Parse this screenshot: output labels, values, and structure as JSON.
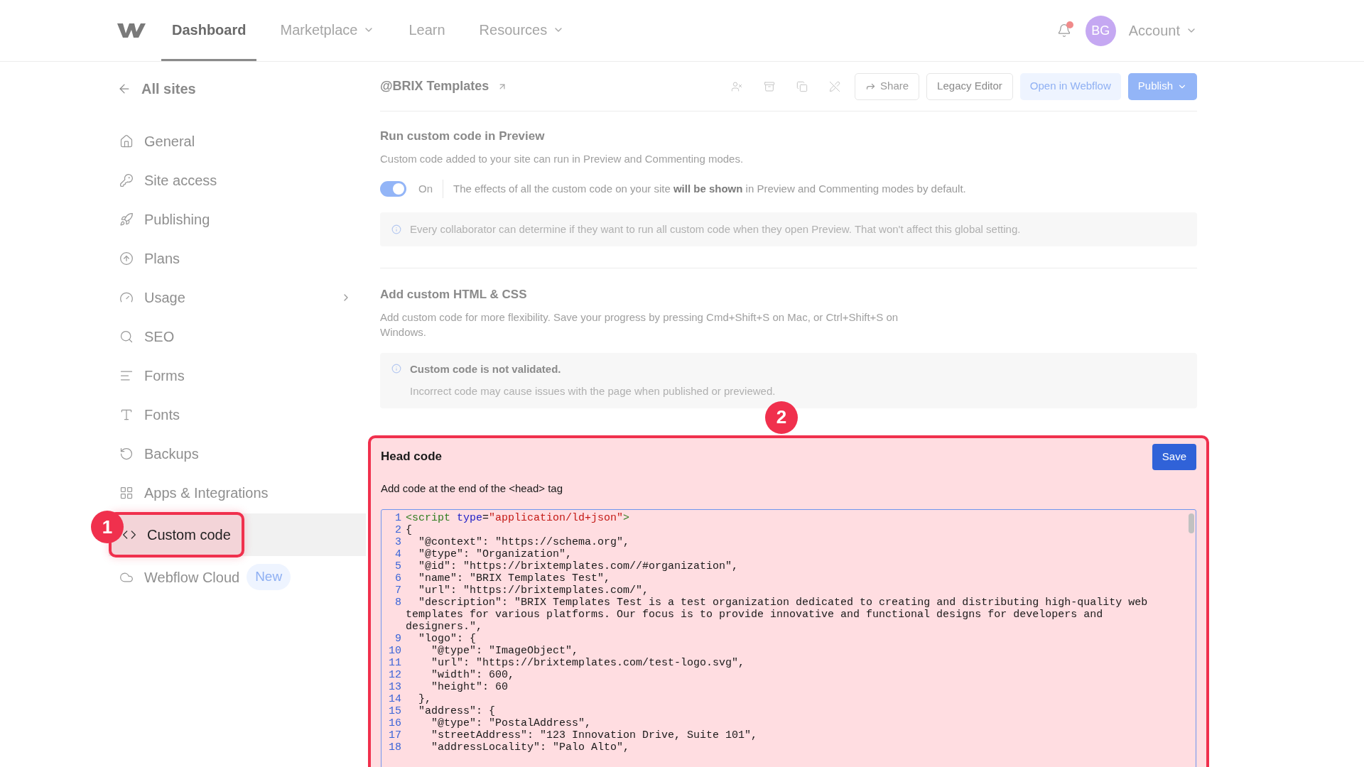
{
  "nav": {
    "items": [
      {
        "label": "Dashboard",
        "selected": true,
        "dropdown": false
      },
      {
        "label": "Marketplace",
        "selected": false,
        "dropdown": true
      },
      {
        "label": "Learn",
        "selected": false,
        "dropdown": false
      },
      {
        "label": "Resources",
        "selected": false,
        "dropdown": true
      }
    ],
    "notifications": {
      "unread": true
    },
    "avatar": "BG",
    "account": "Account"
  },
  "sidebar": {
    "back": "All sites",
    "items": [
      {
        "label": "General",
        "selected": false
      },
      {
        "label": "Site access",
        "selected": false
      },
      {
        "label": "Publishing",
        "selected": false
      },
      {
        "label": "Plans",
        "selected": false
      },
      {
        "label": "Usage",
        "selected": false,
        "has_submenu": true
      },
      {
        "label": "SEO",
        "selected": false
      },
      {
        "label": "Forms",
        "selected": false
      },
      {
        "label": "Fonts",
        "selected": false
      },
      {
        "label": "Backups",
        "selected": false
      },
      {
        "label": "Apps & Integrations",
        "selected": false
      },
      {
        "label": "Custom code",
        "selected": true,
        "annotation": "1"
      },
      {
        "label": "Webflow Cloud",
        "selected": false,
        "badge": "New"
      }
    ]
  },
  "header": {
    "site": "@BRIX Templates",
    "buttons": [
      {
        "label": "Share",
        "kind": "share"
      },
      {
        "label": "Legacy Editor",
        "kind": "plain"
      },
      {
        "label": "Open in Webflow",
        "kind": "soft"
      },
      {
        "label": "Publish",
        "kind": "primary"
      }
    ]
  },
  "preview_section": {
    "title": "Run custom code in Preview",
    "description": "Custom code added to your site can run in Preview and Commenting modes.",
    "toggle": {
      "on": true,
      "label": "On"
    },
    "toggle_text": "The effects of all the custom code on your site **will be shown** in Preview and Commenting modes by default.",
    "info": "Every collaborator can determine if they want to run all custom code when they open Preview. That won't affect this global setting."
  },
  "html_section": {
    "title": "Add custom HTML & CSS",
    "description": "Add custom code for more flexibility. Save your progress by pressing Cmd+Shift+S on Mac, or Ctrl+Shift+S on Windows.",
    "info_title": "Custom code is not validated.",
    "info_text": "Incorrect code may cause issues with the page when published or previewed."
  },
  "head_code": {
    "annotation": "2",
    "title": "Head code",
    "save": "Save",
    "hint": "Add code at the end of the <head> tag",
    "lines": [
      {
        "number": "1",
        "parts": [
          {
            "kind": "tag",
            "text": "<script"
          },
          {
            "kind": "attr",
            "text": " type"
          },
          {
            "kind": "plain",
            "text": "="
          },
          {
            "kind": "string",
            "text": "\"application/ld+json\""
          },
          {
            "kind": "tag",
            "text": ">"
          }
        ]
      },
      {
        "number": "2",
        "parts": [
          {
            "kind": "plain",
            "text": "{"
          }
        ]
      },
      {
        "number": "3",
        "parts": [
          {
            "kind": "plain",
            "text": "  \"@context\": \"https://schema.org\","
          }
        ]
      },
      {
        "number": "4",
        "parts": [
          {
            "kind": "plain",
            "text": "  \"@type\": \"Organization\","
          }
        ]
      },
      {
        "number": "5",
        "parts": [
          {
            "kind": "plain",
            "text": "  \"@id\": \"https://brixtemplates.com//#organization\","
          }
        ]
      },
      {
        "number": "6",
        "parts": [
          {
            "kind": "plain",
            "text": "  \"name\": \"BRIX Templates Test\","
          }
        ]
      },
      {
        "number": "7",
        "parts": [
          {
            "kind": "plain",
            "text": "  \"url\": \"https://brixtemplates.com/\","
          }
        ]
      },
      {
        "number": "8",
        "parts": [
          {
            "kind": "plain",
            "text": "  \"description\": \"BRIX Templates Test is a test organization dedicated to creating and distributing high-quality web templates for various platforms. Our focus is to provide innovative and functional designs for developers and designers.\","
          }
        ]
      },
      {
        "number": "9",
        "parts": [
          {
            "kind": "plain",
            "text": "  \"logo\": {"
          }
        ]
      },
      {
        "number": "10",
        "parts": [
          {
            "kind": "plain",
            "text": "    \"@type\": \"ImageObject\","
          }
        ]
      },
      {
        "number": "11",
        "parts": [
          {
            "kind": "plain",
            "text": "    \"url\": \"https://brixtemplates.com/test-logo.svg\","
          }
        ]
      },
      {
        "number": "12",
        "parts": [
          {
            "kind": "plain",
            "text": "    \"width\": 600,"
          }
        ]
      },
      {
        "number": "13",
        "parts": [
          {
            "kind": "plain",
            "text": "    \"height\": 60"
          }
        ]
      },
      {
        "number": "14",
        "parts": [
          {
            "kind": "plain",
            "text": "  },"
          }
        ]
      },
      {
        "number": "15",
        "parts": [
          {
            "kind": "plain",
            "text": "  \"address\": {"
          }
        ]
      },
      {
        "number": "16",
        "parts": [
          {
            "kind": "plain",
            "text": "    \"@type\": \"PostalAddress\","
          }
        ]
      },
      {
        "number": "17",
        "parts": [
          {
            "kind": "plain",
            "text": "    \"streetAddress\": \"123 Innovation Drive, Suite 101\","
          }
        ]
      },
      {
        "number": "18",
        "parts": [
          {
            "kind": "plain",
            "text": "    \"addressLocality\": \"Palo Alto\","
          }
        ]
      }
    ]
  }
}
